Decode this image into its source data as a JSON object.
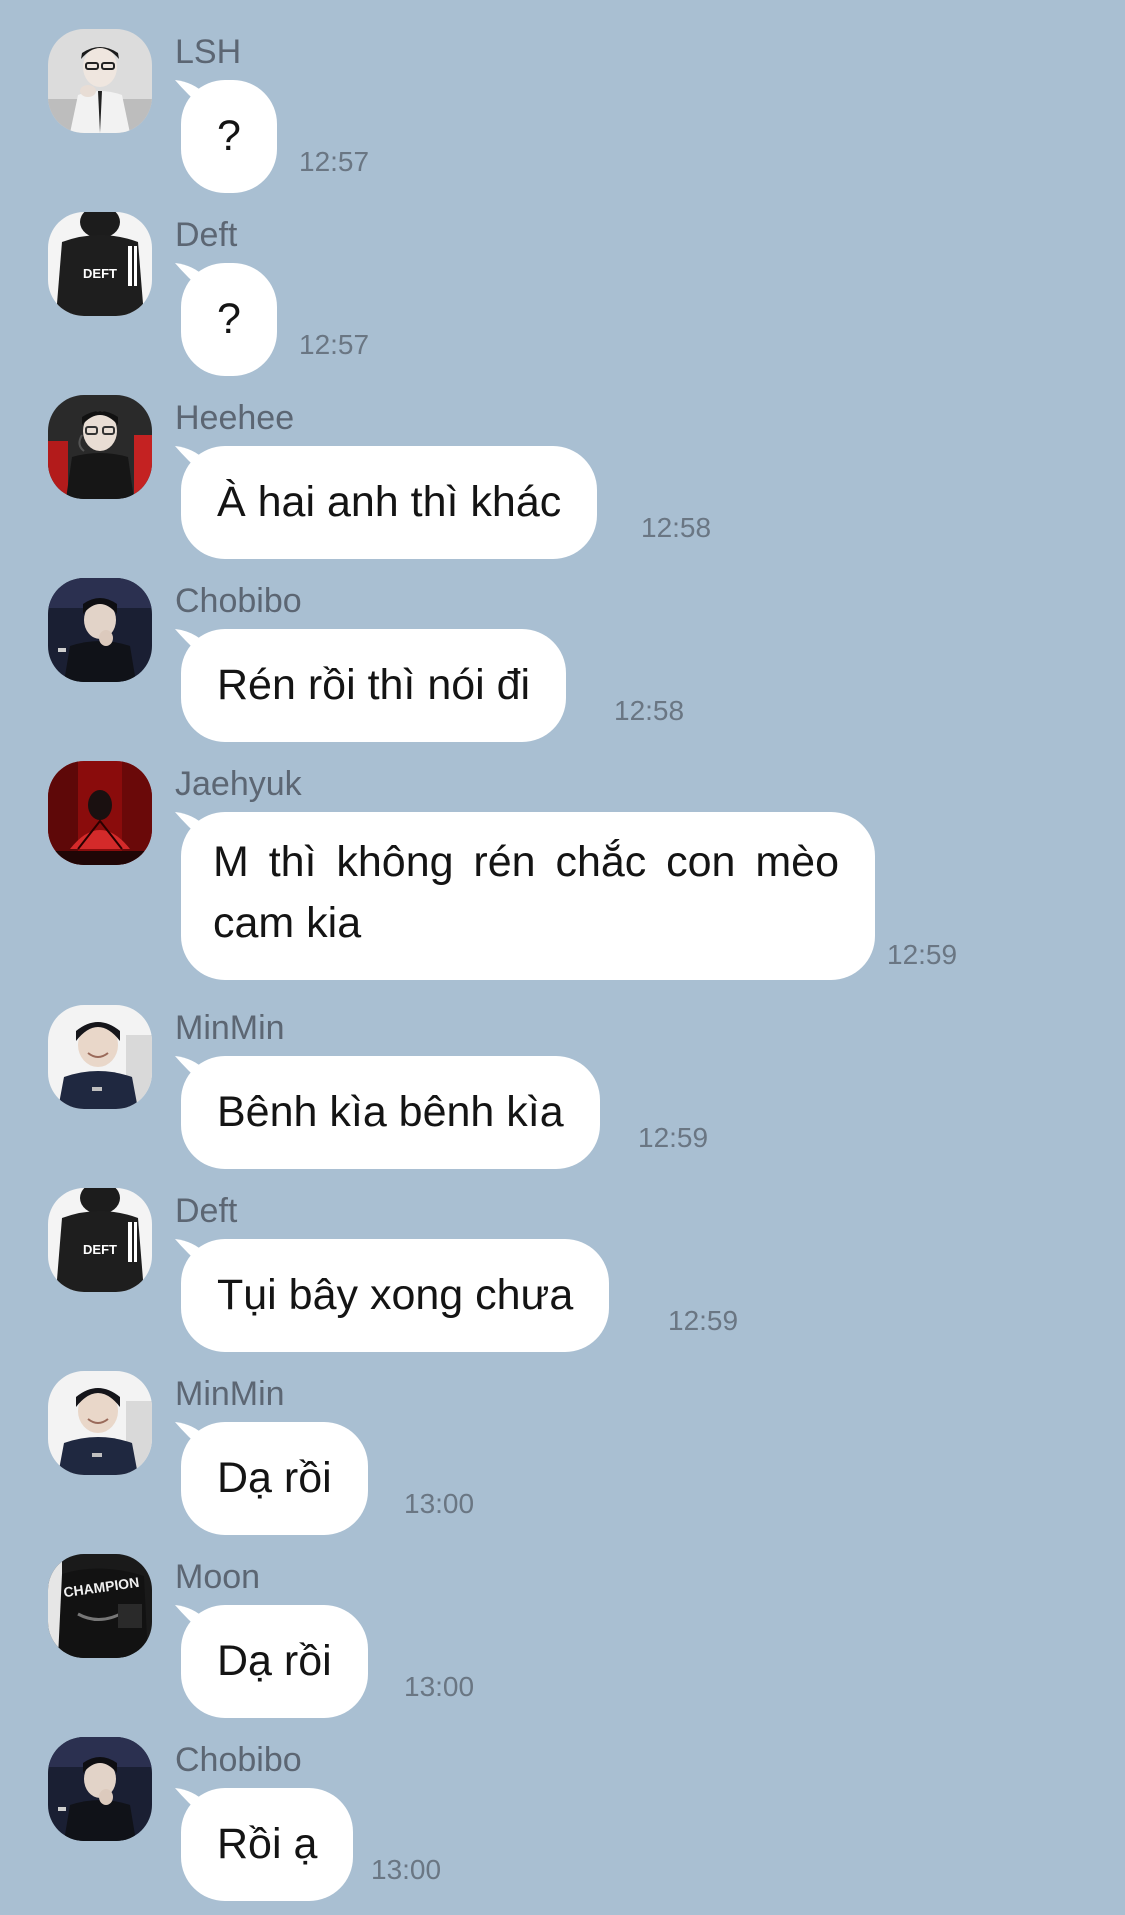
{
  "messages": [
    {
      "sender": "LSH",
      "text": "?",
      "time": "12:57",
      "avatar_icon": "avatar-lsh"
    },
    {
      "sender": "Deft",
      "text": "?",
      "time": "12:57",
      "avatar_icon": "avatar-deft"
    },
    {
      "sender": "Heehee",
      "text": "À hai anh thì khác",
      "time": "12:58",
      "avatar_icon": "avatar-heehee"
    },
    {
      "sender": "Chobibo",
      "text": "Rén rồi thì nói đi",
      "time": "12:58",
      "avatar_icon": "avatar-chobibo"
    },
    {
      "sender": "Jaehyuk",
      "text": "M thì không rén chắc con mèo cam kia",
      "time": "12:59",
      "avatar_icon": "avatar-jaehyuk"
    },
    {
      "sender": "MinMin",
      "text": "Bênh kìa bênh kìa",
      "time": "12:59",
      "avatar_icon": "avatar-minmin"
    },
    {
      "sender": "Deft",
      "text": "Tụi bây xong chưa",
      "time": "12:59",
      "avatar_icon": "avatar-deft"
    },
    {
      "sender": "MinMin",
      "text": "Dạ rồi",
      "time": "13:00",
      "avatar_icon": "avatar-minmin"
    },
    {
      "sender": "Moon",
      "text": "Dạ rồi",
      "time": "13:00",
      "avatar_icon": "avatar-moon"
    },
    {
      "sender": "Chobibo",
      "text": "Rồi ạ",
      "time": "13:00",
      "avatar_icon": "avatar-chobibo"
    }
  ],
  "avatar_jersey_texts": {
    "deft": "DEFT",
    "moon": "CHAMPION"
  },
  "colors": {
    "background": "#a9bfd2",
    "bubble": "#ffffff",
    "sender_name": "#5c6673",
    "timestamp": "#6a7683",
    "message_text": "#141414"
  }
}
